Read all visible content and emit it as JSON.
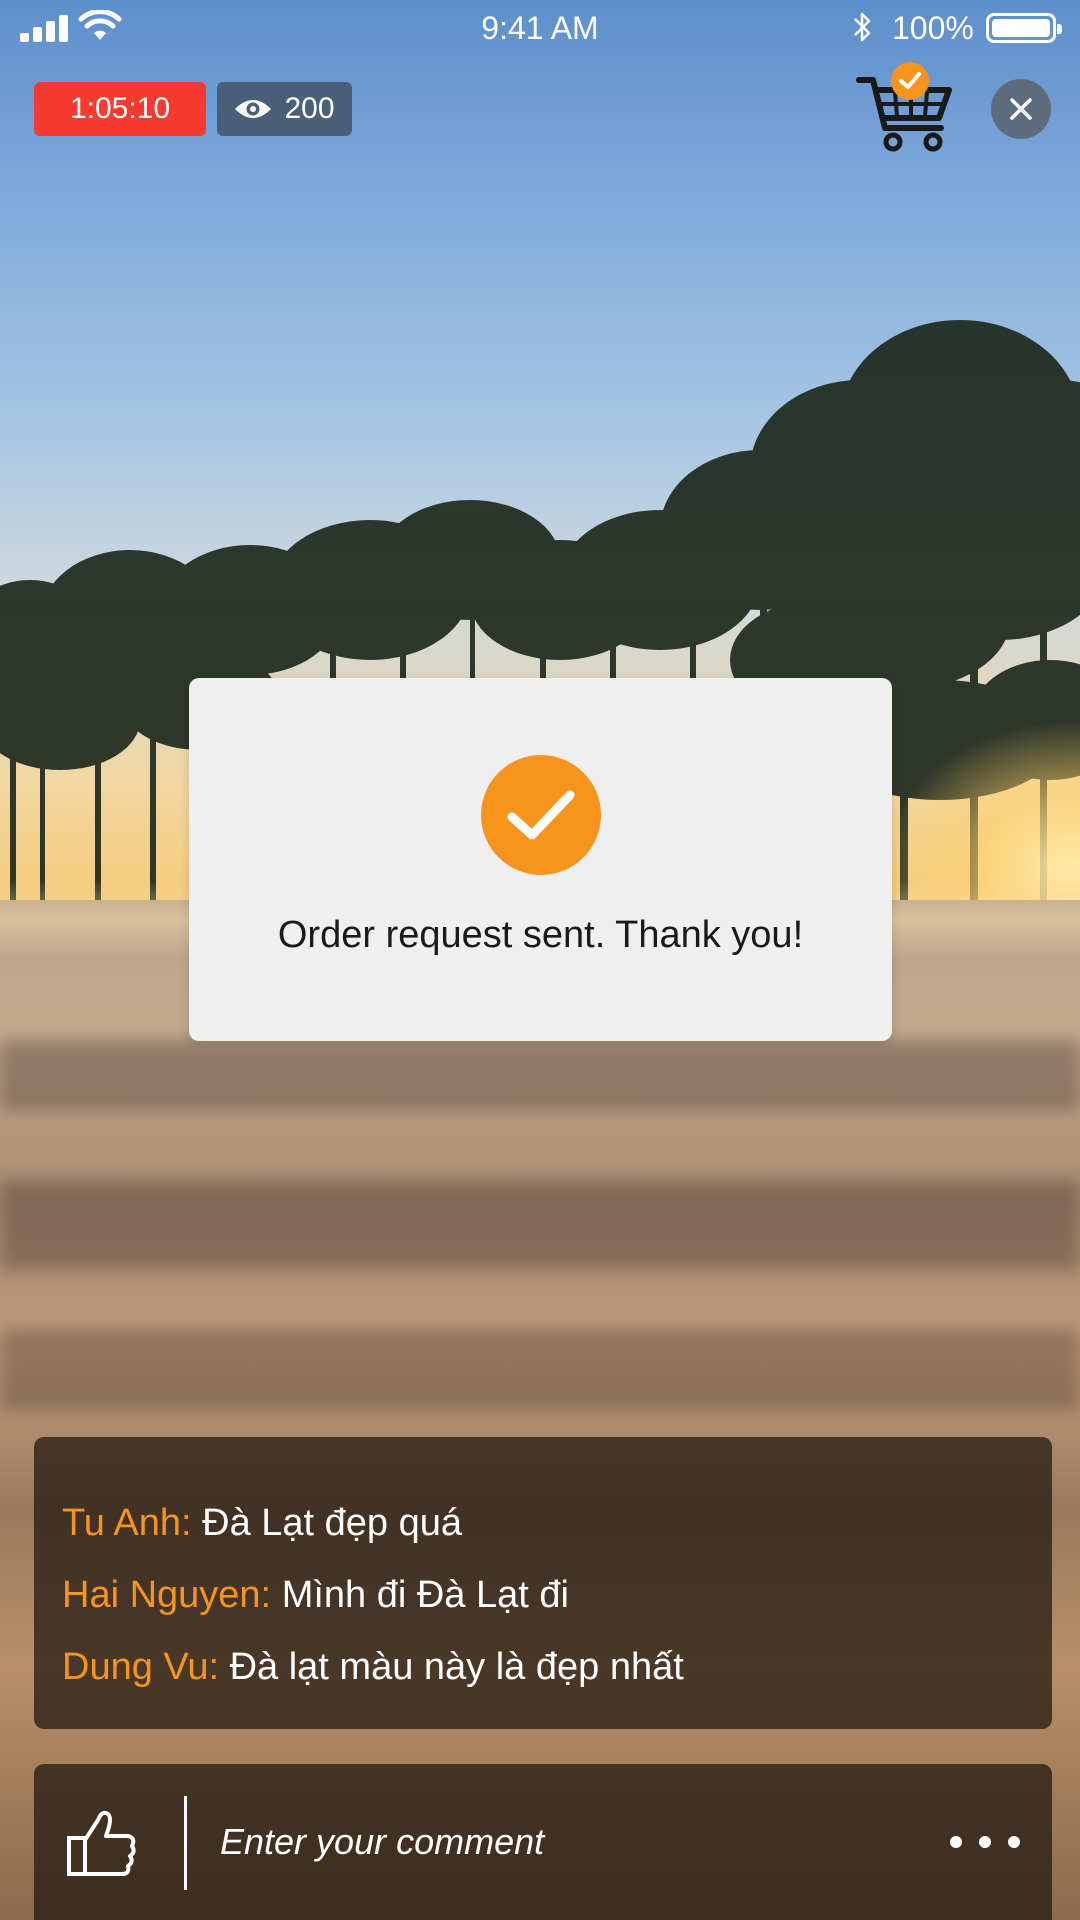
{
  "status_bar": {
    "time": "9:41 AM",
    "battery": "100%",
    "icons": [
      "signal-icon",
      "wifi-icon",
      "bluetooth-icon",
      "battery-icon"
    ]
  },
  "live": {
    "timer": "1:05:10",
    "viewers": "200",
    "timer_color": "#f53b30",
    "viewers_color": "#4a5f78"
  },
  "header": {
    "cart_icon": "shopping-cart-icon",
    "cart_badge_icon": "check-icon",
    "close_icon": "close-icon"
  },
  "dialog": {
    "icon": "check-circle-icon",
    "message": "Order request sent. Thank you!",
    "accent": "#f7941d"
  },
  "chat": {
    "messages": [
      {
        "user": "Tu Anh:",
        "text": "Đà Lạt đẹp quá"
      },
      {
        "user": "Hai Nguyen:",
        "text": "Mình đi Đà Lạt đi"
      },
      {
        "user": "Dung Vu:",
        "text": "Đà lạt màu này là đẹp nhất"
      }
    ],
    "username_color": "#f7941d"
  },
  "comment_bar": {
    "like_icon": "thumbs-up-icon",
    "placeholder": "Enter your comment",
    "more_icon": "more-dots-icon"
  }
}
